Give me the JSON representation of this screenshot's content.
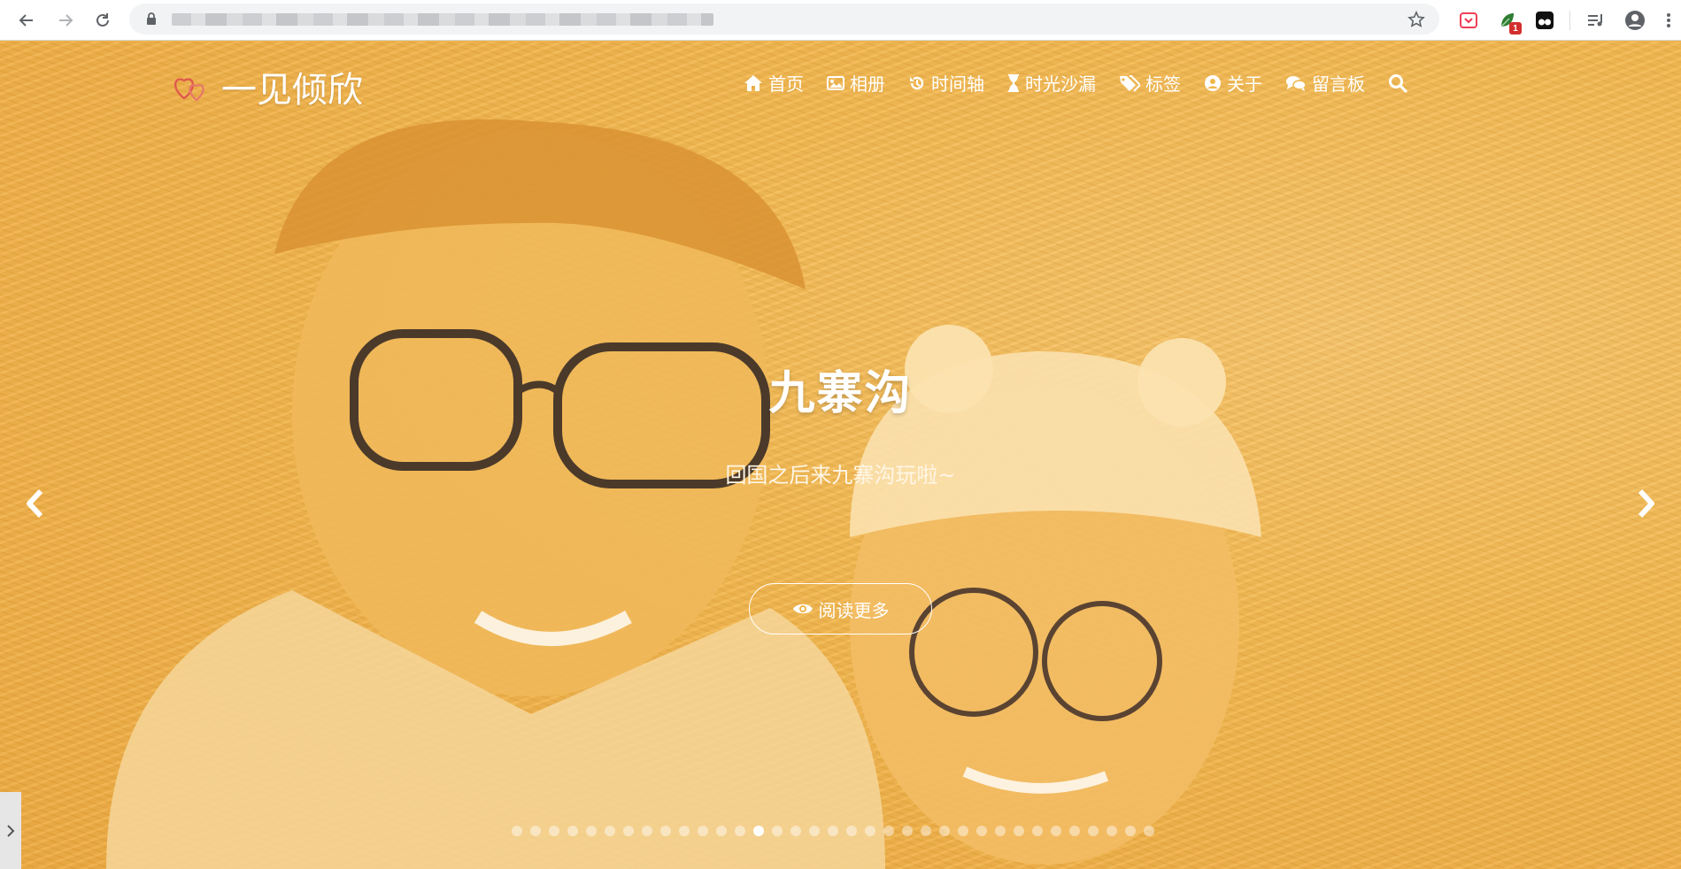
{
  "browser": {
    "back_icon": "arrow-left-icon",
    "forward_icon": "arrow-right-icon",
    "reload_icon": "reload-icon",
    "lock_icon": "lock-icon",
    "bookmark_icon": "star-icon",
    "extensions": [
      {
        "name": "pocket-extension-icon",
        "color": "#ef3f56"
      },
      {
        "name": "leaf-extension-icon",
        "color": "#2e7d32",
        "badge": "1"
      },
      {
        "name": "tampermonkey-extension-icon",
        "color": "#000000"
      },
      {
        "name": "media-queue-icon",
        "color": "#5f6368"
      },
      {
        "name": "profile-avatar-icon",
        "color": "#5f6368"
      },
      {
        "name": "more-vert-icon",
        "color": "#5f6368"
      }
    ]
  },
  "site": {
    "title": "一见倾欣",
    "logo_icon": "hearts-icon",
    "accent_color": "#e05a4e"
  },
  "nav": {
    "items": [
      {
        "label": "首页",
        "icon": "home-icon"
      },
      {
        "label": "相册",
        "icon": "image-icon"
      },
      {
        "label": "时间轴",
        "icon": "history-icon"
      },
      {
        "label": "时光沙漏",
        "icon": "hourglass-icon"
      },
      {
        "label": "标签",
        "icon": "tags-icon"
      },
      {
        "label": "关于",
        "icon": "user-circle-icon"
      },
      {
        "label": "留言板",
        "icon": "comments-icon"
      }
    ],
    "search_icon": "search-icon"
  },
  "carousel": {
    "title": "九寨沟",
    "subtitle": "回国之后来九寨沟玩啦~",
    "read_more": "阅读更多",
    "read_more_icon": "eye-icon",
    "prev_icon": "chevron-left-icon",
    "next_icon": "chevron-right-icon",
    "slide_count": 35,
    "active_slide": 13,
    "overlay_color": "#f2b64c"
  },
  "side_tab_icon": "chevron-right-icon"
}
